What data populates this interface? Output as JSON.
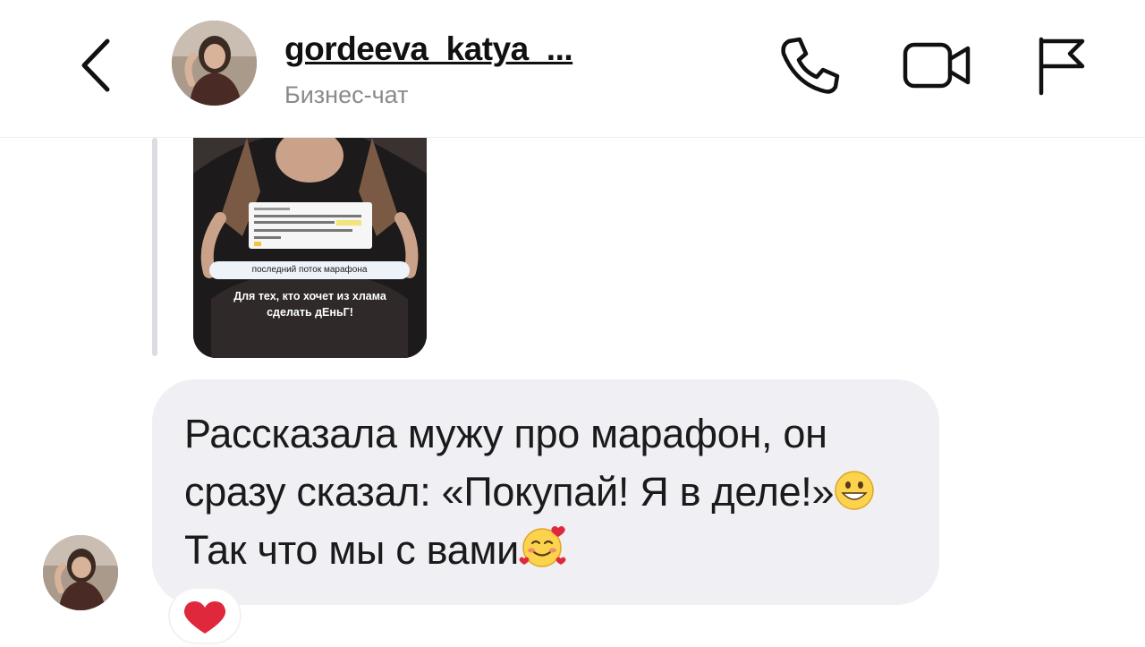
{
  "header": {
    "username": "gordeeva_katya_...",
    "subtitle": "Бизнес-чат",
    "back_icon": "chevron-left-icon",
    "actions": [
      "phone-icon",
      "video-camera-icon",
      "flag-icon"
    ]
  },
  "shared_post": {
    "tag": "последний поток марафона",
    "caption": "Для тех, кто хочет из хлама сделать дЕньГ!"
  },
  "message": {
    "text_part1": "Рассказала мужу про марафон, он сразу сказал: «Покупай! Я в деле!»",
    "emoji1": "grinning-face-icon",
    "text_part2": "Так что мы с вами",
    "emoji2": "smiling-face-with-hearts-icon"
  },
  "reaction": {
    "icon": "red-heart-icon"
  },
  "colors": {
    "bubble": "#efeff4",
    "text": "#1a1a1a",
    "subtitle": "#8a8a8a",
    "heart": "#e0283c"
  }
}
